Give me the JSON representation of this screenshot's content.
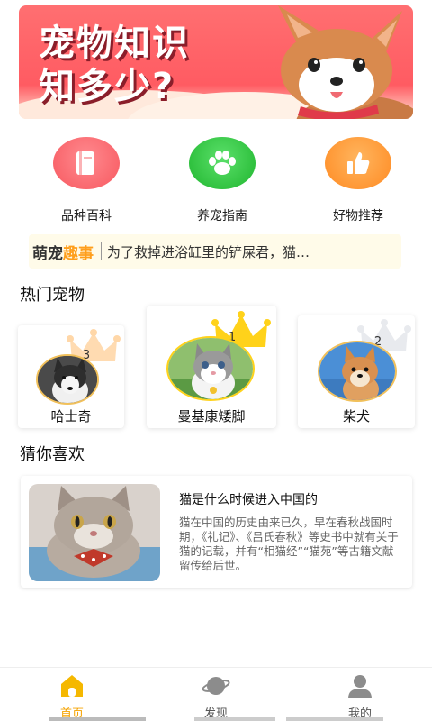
{
  "banner": {
    "line1": "宠物知识",
    "line2": "知多少?"
  },
  "categories": [
    {
      "label": "品种百科",
      "icon": "book-icon",
      "color": "#f7656b"
    },
    {
      "label": "养宠指南",
      "icon": "paw-icon",
      "color": "#34c840"
    },
    {
      "label": "好物推荐",
      "icon": "thumbs-up-icon",
      "color": "#ff9d3b"
    }
  ],
  "news": {
    "tag_part1": "萌宠",
    "tag_part2": "趣事",
    "text": "为了救掉进浴缸里的铲屎君，猫…"
  },
  "hot_pets": {
    "title": "热门宠物",
    "items": [
      {
        "rank": "3",
        "name": "哈士奇"
      },
      {
        "rank": "1",
        "name": "曼基康矮脚"
      },
      {
        "rank": "2",
        "name": "柴犬"
      }
    ]
  },
  "guess": {
    "title": "猜你喜欢",
    "article": {
      "title": "猫是什么时候进入中国的",
      "desc": "猫在中国的历史由来已久，早在春秋战国时期，《礼记》、《吕氏春秋》等史书中就有关于猫的记载，并有“相猫经”“猫苑”等古籍文献留传给后世。"
    }
  },
  "nav": [
    {
      "label": "首页",
      "icon": "home-icon",
      "active": true
    },
    {
      "label": "发现",
      "icon": "planet-icon",
      "active": false
    },
    {
      "label": "我的",
      "icon": "user-icon",
      "active": false
    }
  ],
  "colors": {
    "accent": "#f5a300",
    "banner": "#ff5b62",
    "highlight": "#ffd54a"
  }
}
